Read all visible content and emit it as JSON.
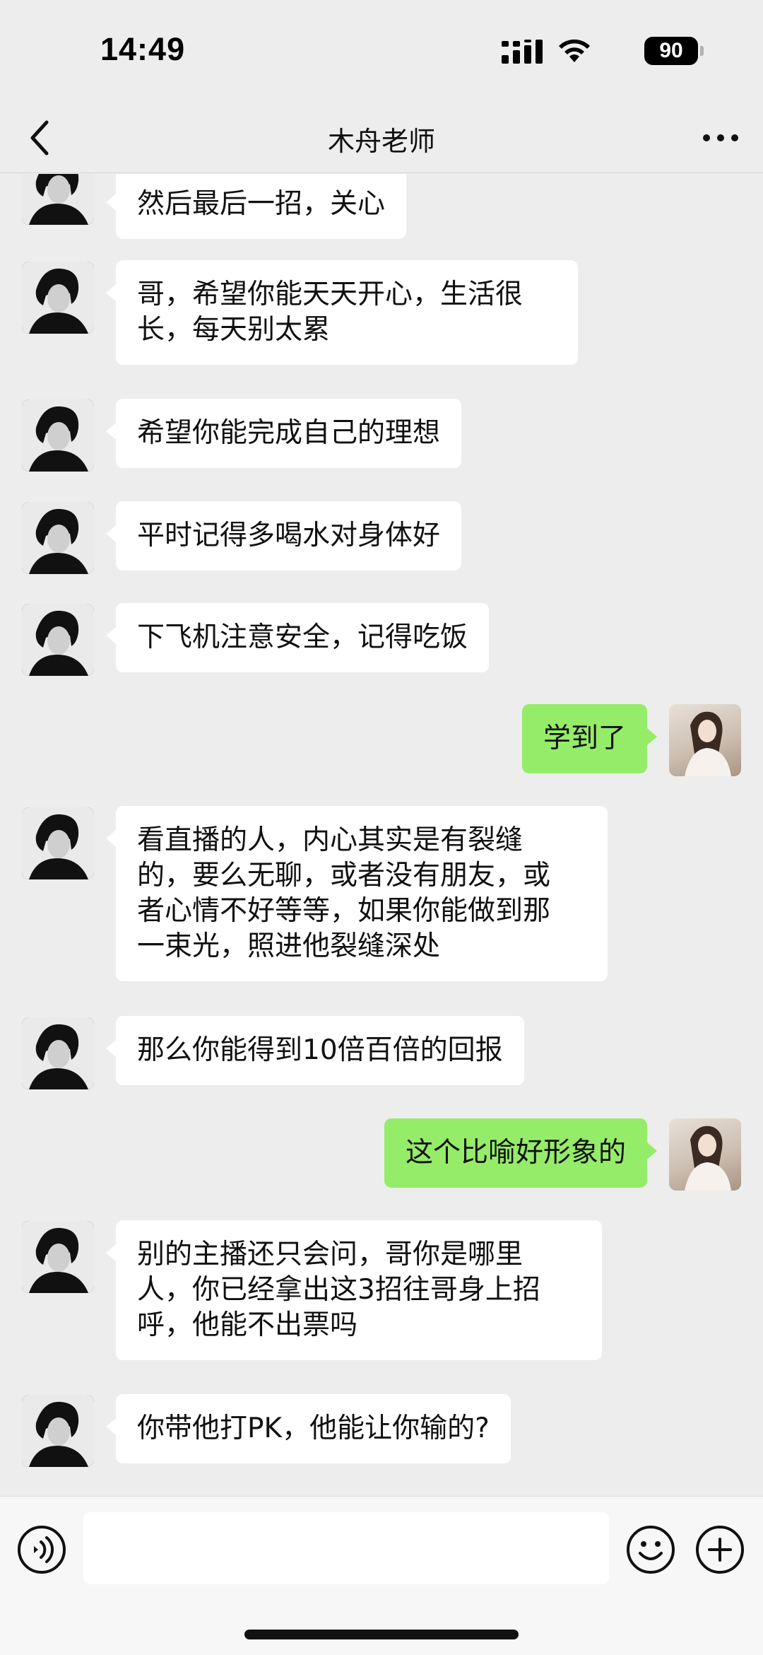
{
  "status_bar": {
    "time": "14:49",
    "battery": "90"
  },
  "header": {
    "title": "木舟老师"
  },
  "messages": [
    {
      "sender": "other",
      "text": "然后最后一招，关心"
    },
    {
      "sender": "other",
      "text": "哥，希望你能天天开心，生活很\n长，每天别太累"
    },
    {
      "sender": "other",
      "text": "希望你能完成自己的理想"
    },
    {
      "sender": "other",
      "text": "平时记得多喝水对身体好"
    },
    {
      "sender": "other",
      "text": "下飞机注意安全，记得吃饭"
    },
    {
      "sender": "me",
      "text": "学到了"
    },
    {
      "sender": "other",
      "text": "看直播的人，内心其实是有裂缝\n的，要么无聊，或者没有朋友，或\n者心情不好等等，如果你能做到那\n一束光，照进他裂缝深处"
    },
    {
      "sender": "other",
      "text": "那么你能得到10倍百倍的回报"
    },
    {
      "sender": "me",
      "text": "这个比喻好形象的"
    },
    {
      "sender": "other",
      "text": "别的主播还只会问，哥你是哪里\n人，你已经拿出这3招往哥身上招\n呼，他能不出票吗"
    },
    {
      "sender": "other",
      "text": "你带他打PK，他能让你输的?"
    }
  ],
  "input_bar": {
    "value": "",
    "icons": [
      "voice-icon",
      "emoji-icon",
      "plus-icon"
    ]
  },
  "colors": {
    "background": "#ededed",
    "my_bubble": "#95ec69",
    "other_bubble": "#ffffff"
  }
}
